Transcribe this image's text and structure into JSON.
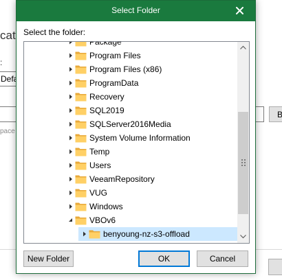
{
  "background_window": {
    "heading_fragment": "catio",
    "label_fragment": ":",
    "input_value_fragment": "Defa",
    "browse_button_fragment": "B",
    "hint_fragment": "pace"
  },
  "dialog": {
    "title": "Select Folder",
    "prompt": "Select the folder:",
    "tree_items": [
      {
        "label": "Package",
        "level": 1,
        "expander": "collapsed",
        "selected": false
      },
      {
        "label": "Program Files",
        "level": 1,
        "expander": "collapsed",
        "selected": false
      },
      {
        "label": "Program Files (x86)",
        "level": 1,
        "expander": "collapsed",
        "selected": false
      },
      {
        "label": "ProgramData",
        "level": 1,
        "expander": "collapsed",
        "selected": false
      },
      {
        "label": "Recovery",
        "level": 1,
        "expander": "collapsed",
        "selected": false
      },
      {
        "label": "SQL2019",
        "level": 1,
        "expander": "collapsed",
        "selected": false
      },
      {
        "label": "SQLServer2016Media",
        "level": 1,
        "expander": "collapsed",
        "selected": false
      },
      {
        "label": "System Volume Information",
        "level": 1,
        "expander": "collapsed",
        "selected": false
      },
      {
        "label": "Temp",
        "level": 1,
        "expander": "collapsed",
        "selected": false
      },
      {
        "label": "Users",
        "level": 1,
        "expander": "collapsed",
        "selected": false
      },
      {
        "label": "VeeamRepository",
        "level": 1,
        "expander": "collapsed",
        "selected": false
      },
      {
        "label": "VUG",
        "level": 1,
        "expander": "collapsed",
        "selected": false
      },
      {
        "label": "Windows",
        "level": 1,
        "expander": "collapsed",
        "selected": false
      },
      {
        "label": "VBOv6",
        "level": 1,
        "expander": "expanded",
        "selected": false
      },
      {
        "label": "benyoung-nz-s3-offload",
        "level": 2,
        "expander": "collapsed",
        "selected": true
      }
    ],
    "buttons": {
      "new_folder": "New Folder",
      "ok": "OK",
      "cancel": "Cancel"
    }
  },
  "icons": {
    "close": "close-icon",
    "folder": "folder-icon",
    "expand": "chevron-right-icon",
    "collapse": "chevron-down-icon",
    "scroll_up": "scroll-up-arrow-icon",
    "scroll_down": "scroll-down-arrow-icon"
  },
  "colors": {
    "title_bar": "#1a7a3e",
    "folder": "#ffd066",
    "selection": "#cce8ff",
    "default_button_border": "#0078d7"
  }
}
